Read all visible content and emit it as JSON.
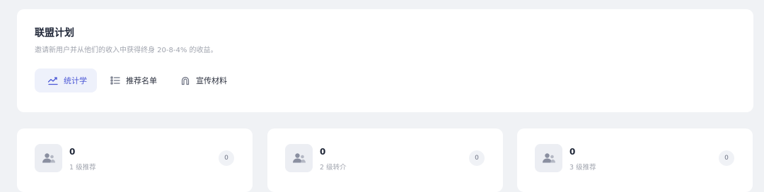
{
  "panel": {
    "title": "联盟计划",
    "subtitle": "邀请新用户并从他们的收入中获得终身 20-8-4% 的收益。"
  },
  "tabs": [
    {
      "label": "统计学",
      "icon": "trend-chart-icon",
      "active": true
    },
    {
      "label": "推荐名单",
      "icon": "list-icon",
      "active": false
    },
    {
      "label": "宣传材料",
      "icon": "magnet-icon",
      "active": false
    }
  ],
  "cards": [
    {
      "count": "0",
      "label": "1 级推荐",
      "badge": "0",
      "icon": "users-icon"
    },
    {
      "count": "0",
      "label": "2 级转介",
      "badge": "0",
      "icon": "users-icon"
    },
    {
      "count": "0",
      "label": "3 级推荐",
      "badge": "0",
      "icon": "users-icon"
    }
  ],
  "colors": {
    "accent": "#4b57d6",
    "background": "#f0f2f5",
    "card": "#ffffff"
  }
}
